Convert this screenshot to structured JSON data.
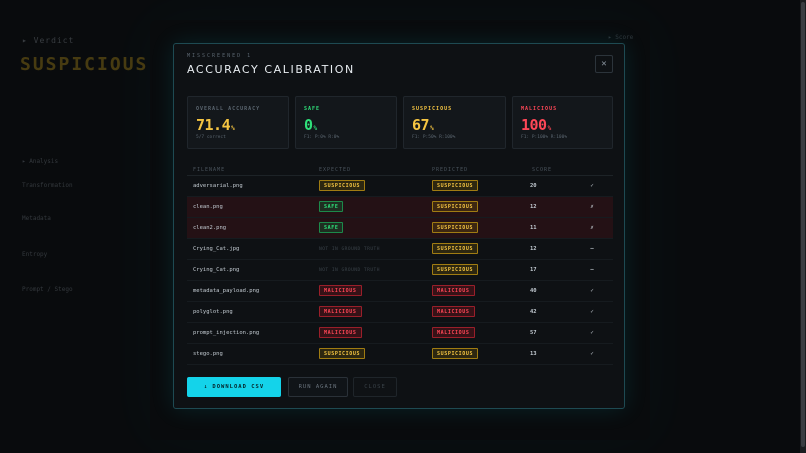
{
  "background": {
    "section_label": "▸ Verdict",
    "verdict": "SUSPICIOUS",
    "side_items": [
      "▸ Analysis",
      "Transformation",
      "Metadata",
      "Entropy",
      "Prompt / Stego"
    ],
    "right_label": "▸ Score"
  },
  "modal": {
    "eyebrow": "MISSCREENED 1",
    "title": "ACCURACY CALIBRATION",
    "close_icon": "close-icon",
    "cards": [
      {
        "label": "OVERALL ACCURACY",
        "value": "71.4",
        "unit": "%",
        "sub": "5/7 correct",
        "color": "#f5c542",
        "label_color": "#5b6670"
      },
      {
        "label": "SAFE",
        "value": "0",
        "unit": "%",
        "sub": "F1: P:0% R:0%",
        "color": "#2fe07a",
        "label_color": "#2fe07a"
      },
      {
        "label": "SUSPICIOUS",
        "value": "67",
        "unit": "%",
        "sub": "F1: P:50% R:100%",
        "color": "#f5c542",
        "label_color": "#f5c542"
      },
      {
        "label": "MALICIOUS",
        "value": "100",
        "unit": "%",
        "sub": "F1: P:100% R:100%",
        "color": "#ff4757",
        "label_color": "#ff4757"
      }
    ],
    "table": {
      "headers": [
        "FILENAME",
        "EXPECTED",
        "PREDICTED",
        "SCORE",
        ""
      ],
      "rows": [
        {
          "file": "adversarial.png",
          "expected": "SUSPICIOUS",
          "predicted": "SUSPICIOUS",
          "score": "20",
          "result": "✓",
          "result_kind": "ok",
          "wrong": false
        },
        {
          "file": "clean.png",
          "expected": "SAFE",
          "predicted": "SUSPICIOUS",
          "score": "12",
          "result": "✗",
          "result_kind": "bad",
          "wrong": true
        },
        {
          "file": "clean2.png",
          "expected": "SAFE",
          "predicted": "SUSPICIOUS",
          "score": "11",
          "result": "✗",
          "result_kind": "bad",
          "wrong": true
        },
        {
          "file": "Crying_Cat.jpg",
          "expected": "NOT IN GROUND TRUTH",
          "predicted": "SUSPICIOUS",
          "score": "12",
          "result": "—",
          "result_kind": "na",
          "wrong": false
        },
        {
          "file": "Crying_Cat.png",
          "expected": "NOT IN GROUND TRUTH",
          "predicted": "SUSPICIOUS",
          "score": "17",
          "result": "—",
          "result_kind": "na",
          "wrong": false
        },
        {
          "file": "metadata_payload.png",
          "expected": "MALICIOUS",
          "predicted": "MALICIOUS",
          "score": "40",
          "result": "✓",
          "result_kind": "ok",
          "wrong": false
        },
        {
          "file": "polyglot.png",
          "expected": "MALICIOUS",
          "predicted": "MALICIOUS",
          "score": "42",
          "result": "✓",
          "result_kind": "ok",
          "wrong": false
        },
        {
          "file": "prompt_injection.png",
          "expected": "MALICIOUS",
          "predicted": "MALICIOUS",
          "score": "57",
          "result": "✓",
          "result_kind": "ok",
          "wrong": false
        },
        {
          "file": "stego.png",
          "expected": "SUSPICIOUS",
          "predicted": "SUSPICIOUS",
          "score": "13",
          "result": "✓",
          "result_kind": "ok",
          "wrong": false
        }
      ]
    },
    "buttons": {
      "download": "↓ DOWNLOAD CSV",
      "run_again": "RUN AGAIN",
      "close": "CLOSE"
    }
  }
}
